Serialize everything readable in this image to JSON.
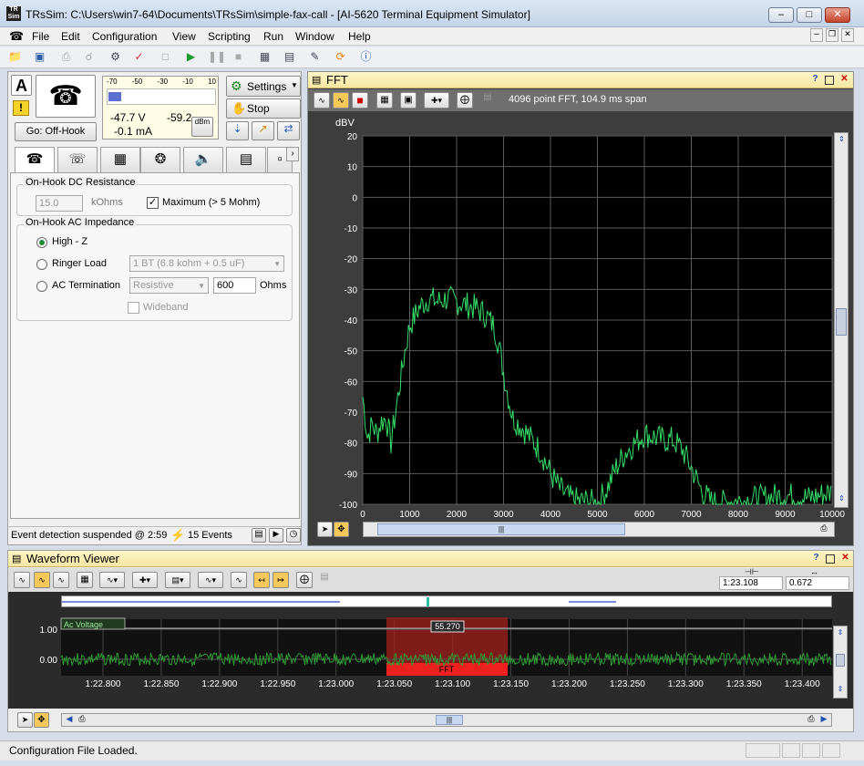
{
  "window": {
    "title": "TRsSim:  C:\\Users\\win7-64\\Documents\\TRsSim\\simple-fax-call - [AI-5620  Terminal Equipment Simulator]",
    "app_icon": "TRsSim"
  },
  "menu": [
    "File",
    "Edit",
    "Configuration",
    "View",
    "Scripting",
    "Run",
    "Window",
    "Help"
  ],
  "left": {
    "line_label": "A",
    "meter": {
      "scale": [
        "-70",
        "-50",
        "-30",
        "-10",
        "10"
      ],
      "voltage": "-47.7  V",
      "current": "-0.1 mA",
      "dbm": "-59.2",
      "dbm_unit": "dBm"
    },
    "go_button": "Go:  Off-Hook",
    "settings_label": "Settings",
    "stop_label": "Stop",
    "tabs": [
      "phone-on-hook-icon",
      "phone-icon",
      "keypad-icon",
      "dial-icon",
      "speaker-icon",
      "meter-icon",
      "more-icon"
    ],
    "dc_group": "On-Hook DC Resistance",
    "dc_value": "15.0",
    "dc_unit": "kOhms",
    "max_label": "Maximum (> 5 Mohm)",
    "ac_group": "On-Hook AC Impedance",
    "opt_highz": "High - Z",
    "opt_ringer": "Ringer Load",
    "ringer_value": "1 BT (6.8 kohm + 0.5 uF)",
    "opt_ac": "AC Termination",
    "ac_type": "Resistive",
    "ac_ohms": "600",
    "ohms_label": "Ohms",
    "wideband": "Wideband",
    "event_status": "Event detection suspended @ 2:59",
    "events": "15 Events"
  },
  "fft": {
    "title": "FFT",
    "info": "4096 point FFT, 104.9 ms span",
    "ylabel": "dBV"
  },
  "chart_data": {
    "type": "line",
    "title": "FFT",
    "ylabel": "dBV",
    "xlabel": "",
    "xlim": [
      0,
      10000
    ],
    "ylim": [
      -100,
      20
    ],
    "x_ticks": [
      "0",
      "1000",
      "2000",
      "3000",
      "4000",
      "5000",
      "6000",
      "7000",
      "8000",
      "9000",
      "10000"
    ],
    "y_ticks": [
      "20",
      "10",
      "0",
      "-10",
      "-20",
      "-30",
      "-40",
      "-50",
      "-60",
      "-70",
      "-80",
      "-90",
      "-100"
    ],
    "series": [
      {
        "color": "#35e06a",
        "x": [
          0,
          100,
          200,
          300,
          400,
          500,
          600,
          700,
          800,
          900,
          1000,
          1200,
          1400,
          1600,
          1800,
          2000,
          2200,
          2400,
          2600,
          2800,
          2900,
          3000,
          3100,
          3200,
          3400,
          3600,
          3800,
          4000,
          4200,
          4400,
          4600,
          4800,
          5000,
          5200,
          5400,
          5600,
          5800,
          6000,
          6200,
          6400,
          6600,
          6800,
          7000,
          7200,
          7400,
          7600,
          7800,
          8000,
          8500,
          9000,
          9500,
          10000
        ],
        "values": [
          -65,
          -78,
          -74,
          -77,
          -73,
          -72,
          -80,
          -70,
          -60,
          -50,
          -42,
          -36,
          -33,
          -34,
          -33,
          -34,
          -35,
          -36,
          -38,
          -42,
          -48,
          -57,
          -65,
          -72,
          -75,
          -79,
          -83,
          -90,
          -95,
          -98,
          -99,
          -99,
          -100,
          -95,
          -88,
          -83,
          -80,
          -77,
          -78,
          -79,
          -79,
          -82,
          -88,
          -95,
          -99,
          -100,
          -99,
          -99,
          -98,
          -97,
          -98,
          -96
        ]
      }
    ]
  },
  "waveform": {
    "title": "Waveform Viewer",
    "cursor_time": "1:23.108",
    "cursor_delta": "0.672",
    "channel": "Ac Voltage",
    "marker": "55.270",
    "fft_tag": "FFT",
    "y_ticks": [
      "1.00",
      "0.00"
    ],
    "x_ticks": [
      "1:22.800",
      "1:22.850",
      "1:22.900",
      "1:22.950",
      "1:23.000",
      "1:23.050",
      "1:23.100",
      "1:23.150",
      "1:23.200",
      "1:23.250",
      "1:23.300",
      "1:23.350",
      "1:23.400"
    ]
  },
  "status": "Configuration File Loaded."
}
